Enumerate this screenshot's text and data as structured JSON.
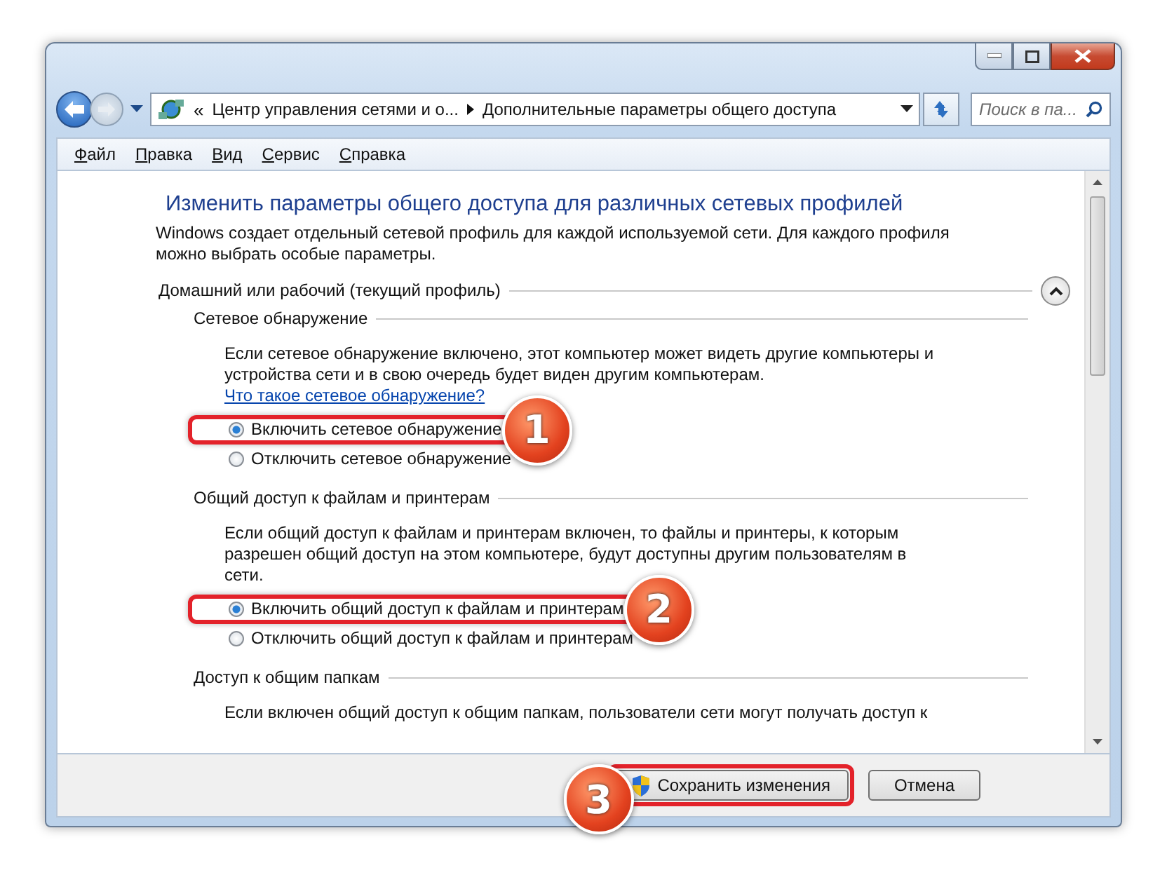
{
  "address_bar": {
    "overflow": "«",
    "breadcrumbs": [
      "Центр управления сетями и о...",
      "Дополнительные параметры общего доступа"
    ],
    "search_placeholder": "Поиск в па..."
  },
  "menu": [
    "Файл",
    "Правка",
    "Вид",
    "Сервис",
    "Справка"
  ],
  "content": {
    "title": "Изменить параметры общего доступа для различных сетевых профилей",
    "intro": "Windows создает отдельный сетевой профиль для каждой используемой сети. Для каждого профиля можно выбрать особые параметры.",
    "profile": {
      "label": "Домашний или рабочий (текущий профиль)",
      "expanded": true
    },
    "sections": [
      {
        "heading": "Сетевое обнаружение",
        "description": "Если сетевое обнаружение включено, этот компьютер может видеть другие компьютеры и устройства сети и в свою очередь будет виден другим компьютерам.",
        "link": "Что такое сетевое обнаружение?",
        "options": [
          {
            "label": "Включить сетевое обнаружение",
            "selected": true,
            "callout": "1"
          },
          {
            "label": "Отключить сетевое обнаружение",
            "selected": false
          }
        ]
      },
      {
        "heading": "Общий доступ к файлам и принтерам",
        "description": "Если общий доступ к файлам и принтерам включен, то файлы и принтеры, к которым разрешен общий доступ на этом компьютере, будут доступны другим пользователям в сети.",
        "options": [
          {
            "label": "Включить общий доступ к файлам и принтерам",
            "selected": true,
            "callout": "2"
          },
          {
            "label": "Отключить общий доступ к файлам и принтерам",
            "selected": false
          }
        ]
      },
      {
        "heading": "Доступ к общим папкам",
        "description": "Если включен общий доступ к общим папкам, пользователи сети могут получать доступ к"
      }
    ]
  },
  "buttons": [
    {
      "label": "Сохранить изменения",
      "kind": "shield",
      "callout": "3"
    },
    {
      "label": "Отмена",
      "kind": "plain"
    }
  ]
}
